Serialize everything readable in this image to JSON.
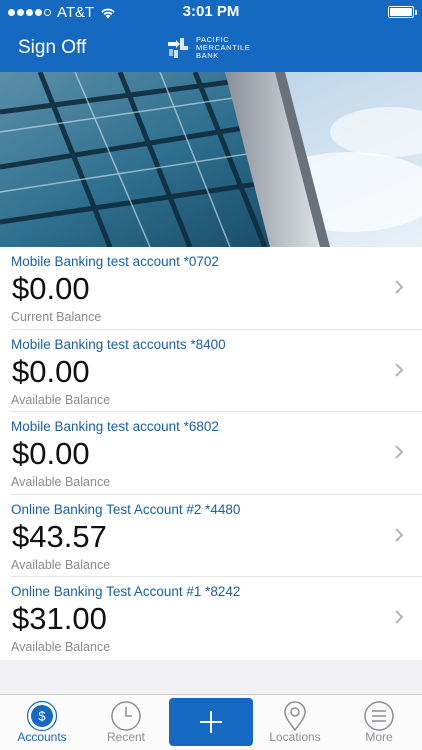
{
  "status_bar": {
    "carrier": "AT&T",
    "time": "3:01 PM",
    "signal_bars": 4,
    "battery_level": 1.0
  },
  "header": {
    "signoff_label": "Sign Off",
    "logo_lines": [
      "PACIFIC",
      "MERCANTILE",
      "BANK"
    ]
  },
  "accounts": [
    {
      "name": "Mobile Banking test account *0702",
      "amount": "$0.00",
      "balance_type": "Current Balance"
    },
    {
      "name": "Mobile Banking test accounts *8400",
      "amount": "$0.00",
      "balance_type": "Available Balance"
    },
    {
      "name": "Mobile Banking test account *6802",
      "amount": "$0.00",
      "balance_type": "Available Balance"
    },
    {
      "name": "Online Banking Test Account #2 *4480",
      "amount": "$43.57",
      "balance_type": "Available Balance"
    },
    {
      "name": "Online Banking Test Account #1 *8242",
      "amount": "$31.00",
      "balance_type": "Available Balance"
    }
  ],
  "tabs": [
    {
      "label": "Accounts",
      "icon": "dollar-circle-icon",
      "active": true
    },
    {
      "label": "Recent",
      "icon": "clock-icon",
      "active": false
    },
    {
      "label": "",
      "icon": "plus-icon",
      "active": false
    },
    {
      "label": "Locations",
      "icon": "map-pin-icon",
      "active": false
    },
    {
      "label": "More",
      "icon": "menu-icon",
      "active": false
    }
  ],
  "colors": {
    "brand": "#1669c0",
    "account_name": "#1b5f9e",
    "secondary_text": "#8a8a8f"
  }
}
